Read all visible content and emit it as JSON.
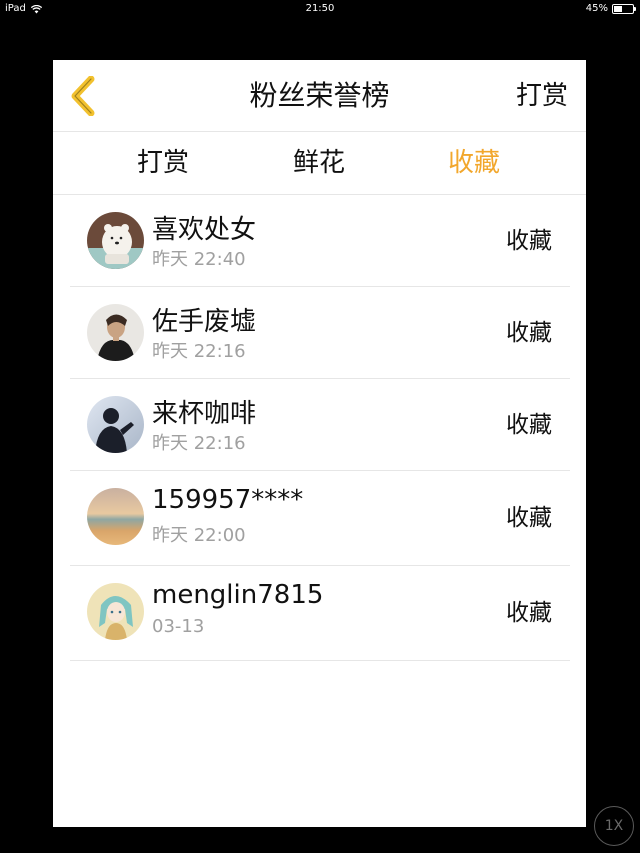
{
  "status_bar": {
    "device": "iPad",
    "time": "21:50",
    "battery_text": "45%",
    "battery_level": 0.45,
    "wifi_icon": "wifi-icon"
  },
  "header": {
    "back_icon": "chevron-left-icon",
    "back_color": "#F2C12E",
    "title": "粉丝荣誉榜",
    "right_action": "打赏"
  },
  "tabs": {
    "active_color": "#F2A72C",
    "items": [
      {
        "label": "打赏",
        "active": false
      },
      {
        "label": "鲜花",
        "active": false
      },
      {
        "label": "收藏",
        "active": true
      }
    ]
  },
  "fans": [
    {
      "name": "喜欢处女",
      "time": "昨天 22:40",
      "action": "收藏",
      "avatar": "bear-avatar"
    },
    {
      "name": "佐手废墟",
      "time": "昨天 22:16",
      "action": "收藏",
      "avatar": "person-avatar"
    },
    {
      "name": "来杯咖啡",
      "time": "昨天 22:16",
      "action": "收藏",
      "avatar": "silhouette-avatar"
    },
    {
      "name": "159957****",
      "time": "昨天 22:00",
      "action": "收藏",
      "avatar": "sunset-avatar"
    },
    {
      "name": "menglin7815",
      "time": "03-13",
      "action": "收藏",
      "avatar": "anime-girl-avatar"
    }
  ],
  "speed_badge": "1X"
}
